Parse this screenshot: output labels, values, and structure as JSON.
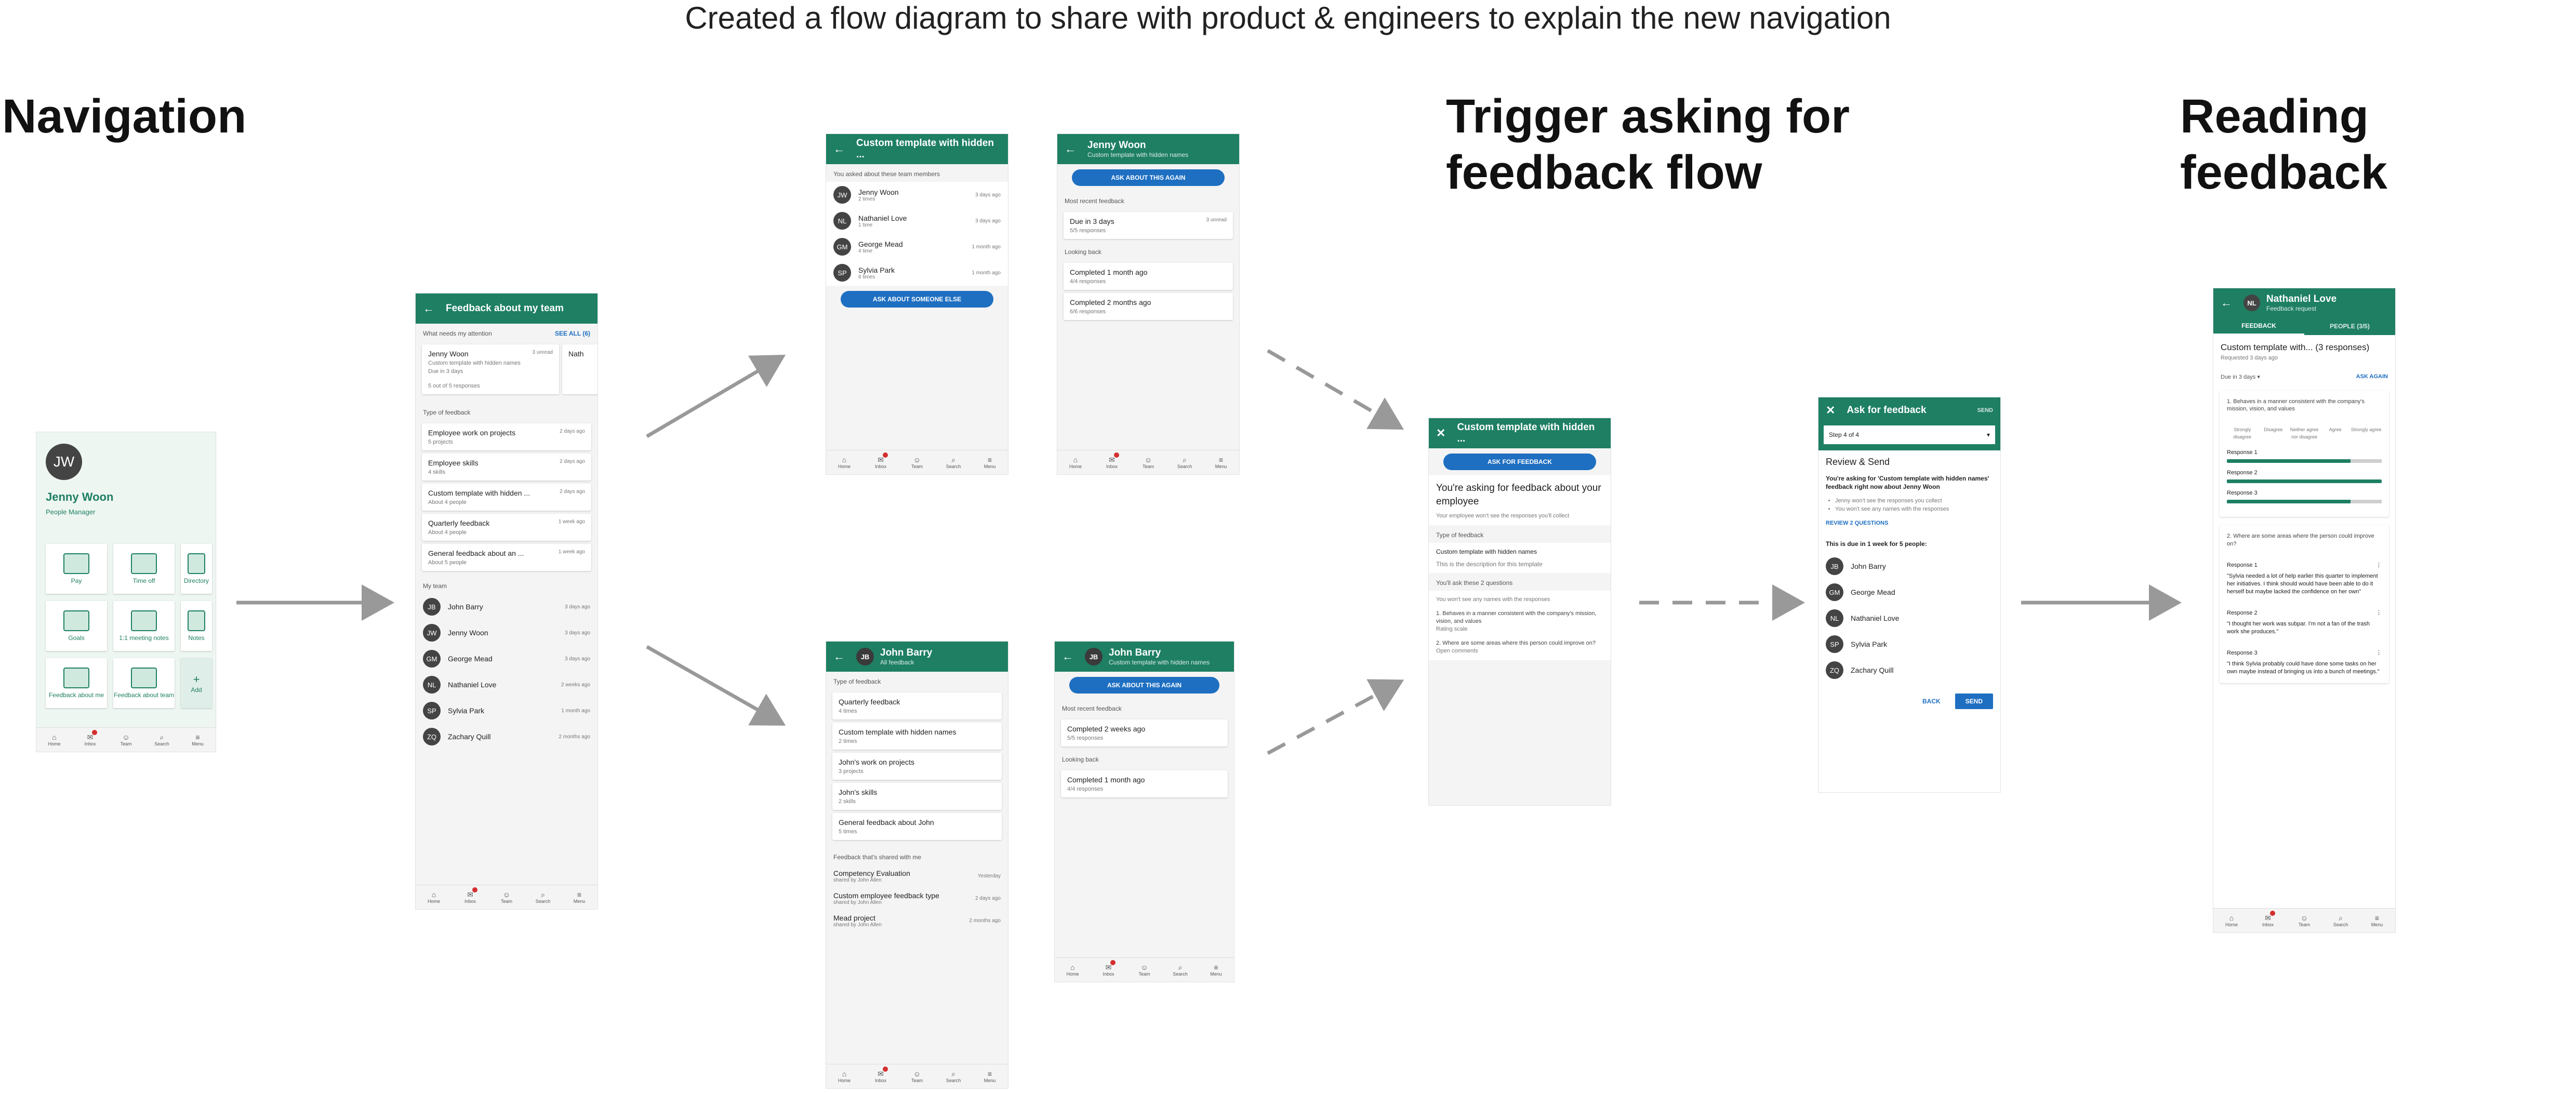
{
  "caption": "Created a flow diagram to share with product & engineers to explain the new navigation",
  "sections": {
    "navigation": "Navigation",
    "trigger": "Trigger asking for feedback flow",
    "reading": "Reading feedback"
  },
  "colors": {
    "primary": "#1e7f63",
    "action": "#1e6fc1",
    "badge": "#d32f2f"
  },
  "tabbar": [
    "Home",
    "Inbox",
    "Team",
    "Search",
    "Menu"
  ],
  "home": {
    "initials": "JW",
    "name": "Jenny Woon",
    "role": "People Manager",
    "tiles": [
      "Pay",
      "Time off",
      "Directory",
      "Goals",
      "1:1 meeting notes",
      "Notes",
      "Feedback about me",
      "Feedback about team",
      "Add"
    ]
  },
  "team": {
    "title": "Feedback about my team",
    "attention": "What needs my attention",
    "see_all": "SEE ALL (6)",
    "card_name": "Jenny Woon",
    "card_time": "3 unread",
    "card_desc": "Custom template with hidden names",
    "card_due": "Due in 3 days",
    "card_count": "5 out of 5 responses",
    "peek": "Nath",
    "type_header": "Type of feedback",
    "types": [
      {
        "title": "Employee work on projects",
        "sub": "5 projects",
        "time": "2 days ago"
      },
      {
        "title": "Employee skills",
        "sub": "4 skills",
        "time": "2 days ago"
      },
      {
        "title": "Custom template with hidden ...",
        "sub": "About 4 people",
        "time": "2 days ago"
      },
      {
        "title": "Quarterly feedback",
        "sub": "About 4 people",
        "time": "1 week ago"
      },
      {
        "title": "General feedback about an ...",
        "sub": "About 5 people",
        "time": "1 week ago"
      }
    ],
    "my_team": "My team",
    "people": [
      {
        "i": "JB",
        "n": "John Barry",
        "t": "3 days ago"
      },
      {
        "i": "JW",
        "n": "Jenny Woon",
        "t": "3 days ago"
      },
      {
        "i": "GM",
        "n": "George Mead",
        "t": "3 days ago"
      },
      {
        "i": "NL",
        "n": "Nathaniel Love",
        "t": "2 weeks ago"
      },
      {
        "i": "SP",
        "n": "Sylvia Park",
        "t": "1 month ago"
      },
      {
        "i": "ZQ",
        "n": "Zachary Quill",
        "t": "2 months ago"
      }
    ]
  },
  "hidden": {
    "title": "Custom template with hidden ...",
    "asked": "You asked about these team members",
    "people": [
      {
        "i": "JW",
        "n": "Jenny Woon",
        "s": "2 times",
        "t": "3 days ago"
      },
      {
        "i": "NL",
        "n": "Nathaniel Love",
        "s": "1 time",
        "t": "3 days ago"
      },
      {
        "i": "GM",
        "n": "George Mead",
        "s": "4 time",
        "t": "1 month ago"
      },
      {
        "i": "SP",
        "n": "Sylvia Park",
        "s": "6 times",
        "t": "1 month ago"
      }
    ],
    "cta": "ASK ABOUT SOMEONE ELSE"
  },
  "jenny": {
    "title": "Jenny Woon",
    "sub": "Custom template with hidden names",
    "cta": "ASK ABOUT THIS AGAIN",
    "recent": "Most recent feedback",
    "recent_card": {
      "title": "Due in 3 days",
      "sub": "5/5 responses",
      "right": "3 unread"
    },
    "looking": "Looking back",
    "back_cards": [
      {
        "title": "Completed 1 month ago",
        "sub": "4/4 responses"
      },
      {
        "title": "Completed 2 months ago",
        "sub": "6/6 responses"
      }
    ]
  },
  "john": {
    "title": "John Barry",
    "sub": "All feedback",
    "type_header": "Type of feedback",
    "types": [
      {
        "title": "Quarterly feedback",
        "sub": "4 times"
      },
      {
        "title": "Custom template with hidden names",
        "sub": "2 times"
      },
      {
        "title": "John's work on projects",
        "sub": "3 projects"
      },
      {
        "title": "John's skills",
        "sub": "2 skills"
      },
      {
        "title": "General feedback about John",
        "sub": "5 times"
      }
    ],
    "shared_header": "Feedback that's shared with me",
    "shared": [
      {
        "title": "Competency Evaluation",
        "sub": "shared by John Allen",
        "t": "Yesterday"
      },
      {
        "title": "Custom employee feedback type",
        "sub": "shared by John Allen",
        "t": "2 days ago"
      },
      {
        "title": "Mead project",
        "sub": "shared by John Allen",
        "t": "2 months ago"
      }
    ]
  },
  "john2": {
    "title": "John Barry",
    "sub": "Custom template with hidden names",
    "cta": "ASK ABOUT THIS AGAIN",
    "recent": "Most recent feedback",
    "recent_card": {
      "title": "Completed 2 weeks ago",
      "sub": "5/5 responses"
    },
    "looking": "Looking back",
    "back_card": {
      "title": "Completed 1 month ago",
      "sub": "4/4 responses"
    }
  },
  "trigger": {
    "title": "Custom template with hidden ...",
    "cta": "ASK FOR FEEDBACK",
    "heading": "You're asking for feedback about your employee",
    "note": "Your employee won't see the responses you'll collect",
    "type_header": "Type of feedback",
    "type_name": "Custom template with hidden names",
    "type_desc": "This is the description for this template",
    "q_header": "You'll ask these 2 questions",
    "anon": "You won't see any names with the responses",
    "q1": "1. Behaves in a manner consistent with the company's mission, vision, and values",
    "q1_type": "Rating scale",
    "q2": "2. Where are some areas where this person could improve on?",
    "q2_type": "Open comments"
  },
  "ask": {
    "title": "Ask for feedback",
    "send_top": "SEND",
    "step": "Step 4 of 4",
    "heading": "Review & Send",
    "intro": "You're asking for 'Custom template with hidden names' feedback right now about Jenny Woon",
    "bullets": [
      "Jenny won't see the responses you collect",
      "You won't see any names with the responses"
    ],
    "review": "REVIEW 2 QUESTIONS",
    "due": "This is due in 1 week for 5 people:",
    "people": [
      {
        "i": "JB",
        "n": "John Barry"
      },
      {
        "i": "GM",
        "n": "George Mead"
      },
      {
        "i": "NL",
        "n": "Nathaniel Love"
      },
      {
        "i": "SP",
        "n": "Sylvia Park"
      },
      {
        "i": "ZQ",
        "n": "Zachary Quill"
      }
    ],
    "back": "BACK",
    "send": "SEND"
  },
  "read": {
    "initials": "NL",
    "title": "Nathaniel Love",
    "sub": "Feedback request",
    "tabs": [
      "FEEDBACK",
      "PEOPLE (3/5)"
    ],
    "heading": "Custom template with... (3 responses)",
    "requested": "Requested 3 days ago",
    "due": "Due in 3 days",
    "ask_again": "ASK AGAIN",
    "q1": "1. Behaves in a manner consistent with the company's mission, vision, and values",
    "scale": [
      "Strongly disagree",
      "Disagree",
      "Neither agree nor disagree",
      "Agree",
      "Strongly agree"
    ],
    "ratings": [
      {
        "label": "Response 1",
        "value": 0.8
      },
      {
        "label": "Response 2",
        "value": 1.0
      },
      {
        "label": "Response 3",
        "value": 0.8
      }
    ],
    "q2": "2. Where are some areas where the person could improve on?",
    "comments": [
      {
        "label": "Response 1",
        "text": "\"Sylvia needed a lot of help earlier this quarter to implement her initiatives. I think should would have been able to do it herself but maybe lacked the confidence on her own\""
      },
      {
        "label": "Response 2",
        "text": "\"I thought her work was subpar. I'm not a fan of the trash work she produces.\""
      },
      {
        "label": "Response 3",
        "text": "\"I think Sylvia probably could have done some tasks on her own maybe instead of bringing us into a bunch of meetings.\""
      }
    ]
  }
}
